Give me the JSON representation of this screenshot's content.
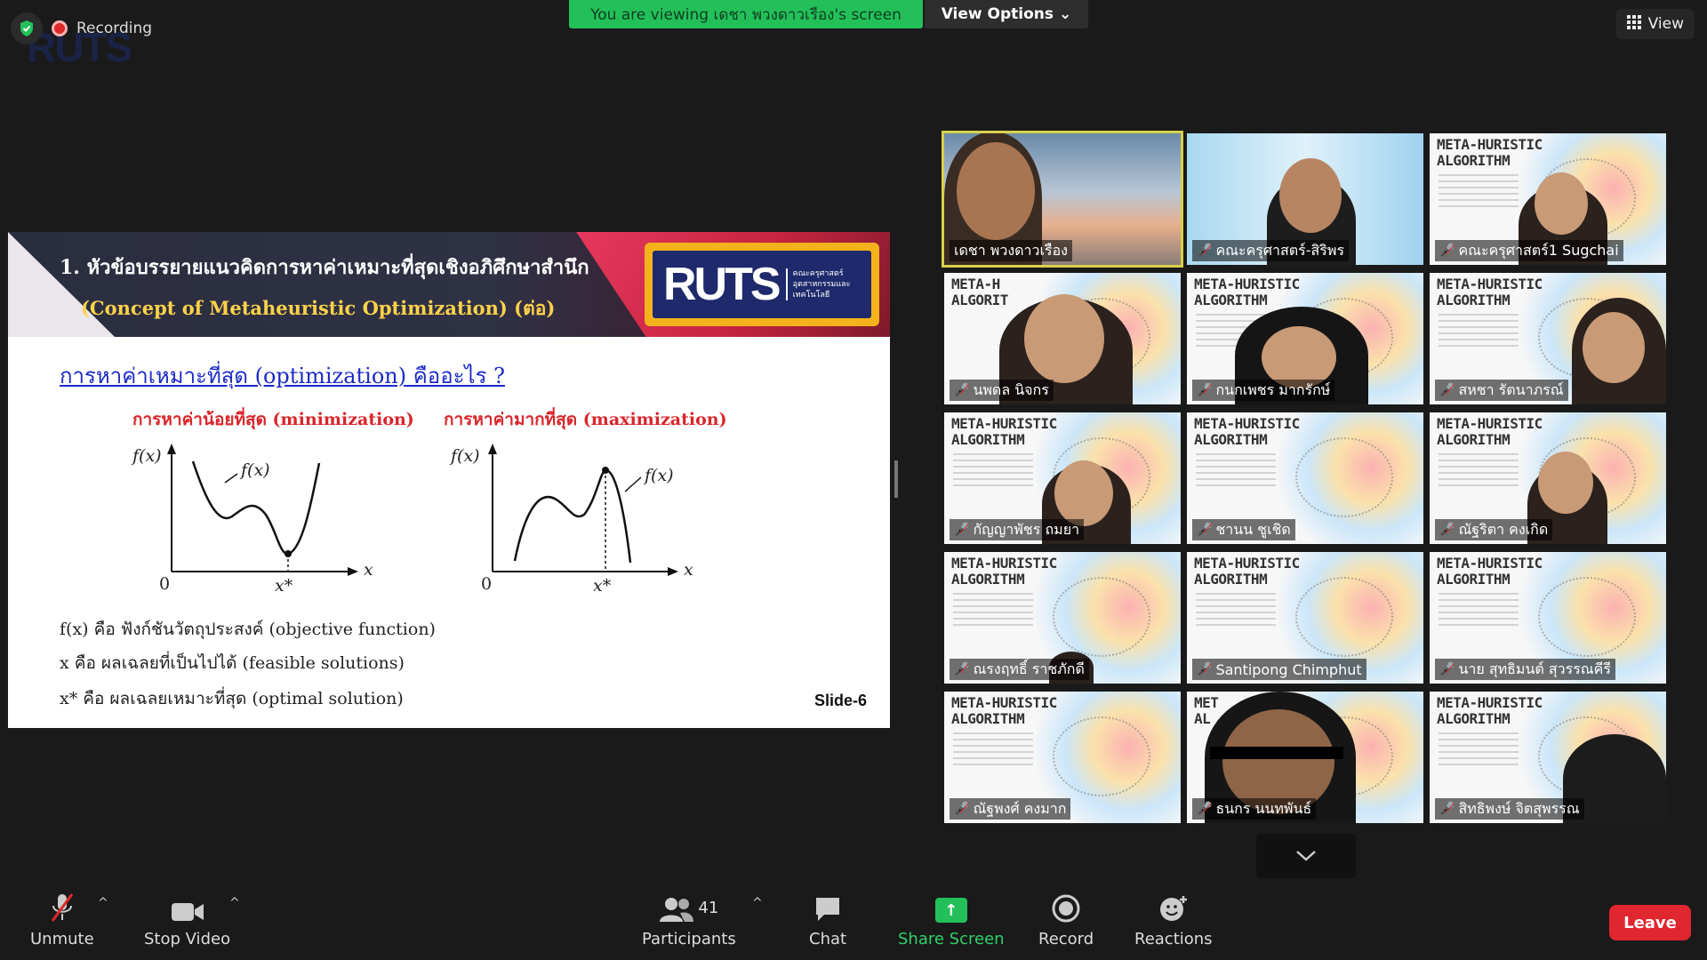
{
  "app": {
    "recording_label": "Recording",
    "ghost_logo": "RUTS"
  },
  "banner": {
    "viewing_text": "You are viewing เดชา พวงดาวเรือง's screen",
    "view_options": "View Options",
    "view_button": "View"
  },
  "slide": {
    "title_line1": "1. หัวข้อบรรยายแนวคิดการหาค่าเหมาะที่สุดเชิงอภิศึกษาสำนึก",
    "title_line2": "(Concept of Metaheuristic Optimization) (ต่อ)",
    "logo_word": "RUTS",
    "logo_sub1": "คณะครุศาสตร์",
    "logo_sub2": "อุตสาหกรรมและเทคโนโลยี",
    "question": "การหาค่าเหมาะที่สุด (optimization) คืออะไร ?",
    "min_label": "การหาค่าน้อยที่สุด (minimization)",
    "max_label": "การหาค่ามากที่สุด (maximization)",
    "fx": "f(x)",
    "x": "x",
    "xstar": "x*",
    "zero": "0",
    "def1": "f(x) คือ ฟังก์ชันวัตถุประสงค์ (objective function)",
    "def2": "x คือ ผลเฉลยที่เป็นไปได้ (feasible solutions)",
    "def3": "x* คือ ผลเฉลยเหมาะที่สุด (optimal solution)",
    "slide_number": "Slide-6"
  },
  "gallery": {
    "poster_title_1": "META-HURISTIC",
    "poster_title_2": "ALGORITHM",
    "poster_title_1_cut": "META-H",
    "poster_title_2_cut": "ALGORIT",
    "poster_title_1_cut2": "MET",
    "poster_title_2_cut2": "AL",
    "participants": [
      {
        "name": "เดชา พวงดาวเรือง",
        "muted": false
      },
      {
        "name": "คณะครุศาสตร์-สิริพร",
        "muted": true
      },
      {
        "name": "คณะครุศาสตร์1 Sugchai",
        "muted": true
      },
      {
        "name": "นพดล นิจกร",
        "muted": true
      },
      {
        "name": "กนกเพชร มากรักษ์",
        "muted": true
      },
      {
        "name": "สหชา รัตนาภรณ์",
        "muted": true
      },
      {
        "name": "กัญญาพัชร ถมยา",
        "muted": true
      },
      {
        "name": "ชานน ชูเชิด",
        "muted": true
      },
      {
        "name": "ณัฐริตา คงเกิด",
        "muted": true
      },
      {
        "name": "ณรงฤทธิ์ ราชภักดี",
        "muted": true
      },
      {
        "name": "Santipong Chimphut",
        "muted": true
      },
      {
        "name": "นาย สุทธิมนต์ สุวรรณคีรี",
        "muted": true
      },
      {
        "name": "ณัฐพงศ์ คงมาก",
        "muted": true
      },
      {
        "name": "ธนกร นนทพันธ์",
        "muted": true
      },
      {
        "name": "สิทธิพงษ์ จิตสุพรรณ",
        "muted": true
      }
    ]
  },
  "toolbar": {
    "unmute": "Unmute",
    "stop_video": "Stop Video",
    "participants": "Participants",
    "participants_count": "41",
    "chat": "Chat",
    "share_screen": "Share Screen",
    "record": "Record",
    "reactions": "Reactions",
    "leave": "Leave"
  },
  "colors": {
    "banner_green": "#23c05a",
    "leave_red": "#e0262e",
    "slide_title_yellow": "#ffd24a",
    "slide_red_text": "#d9262b",
    "slide_blue_link": "#1b2bc8"
  }
}
